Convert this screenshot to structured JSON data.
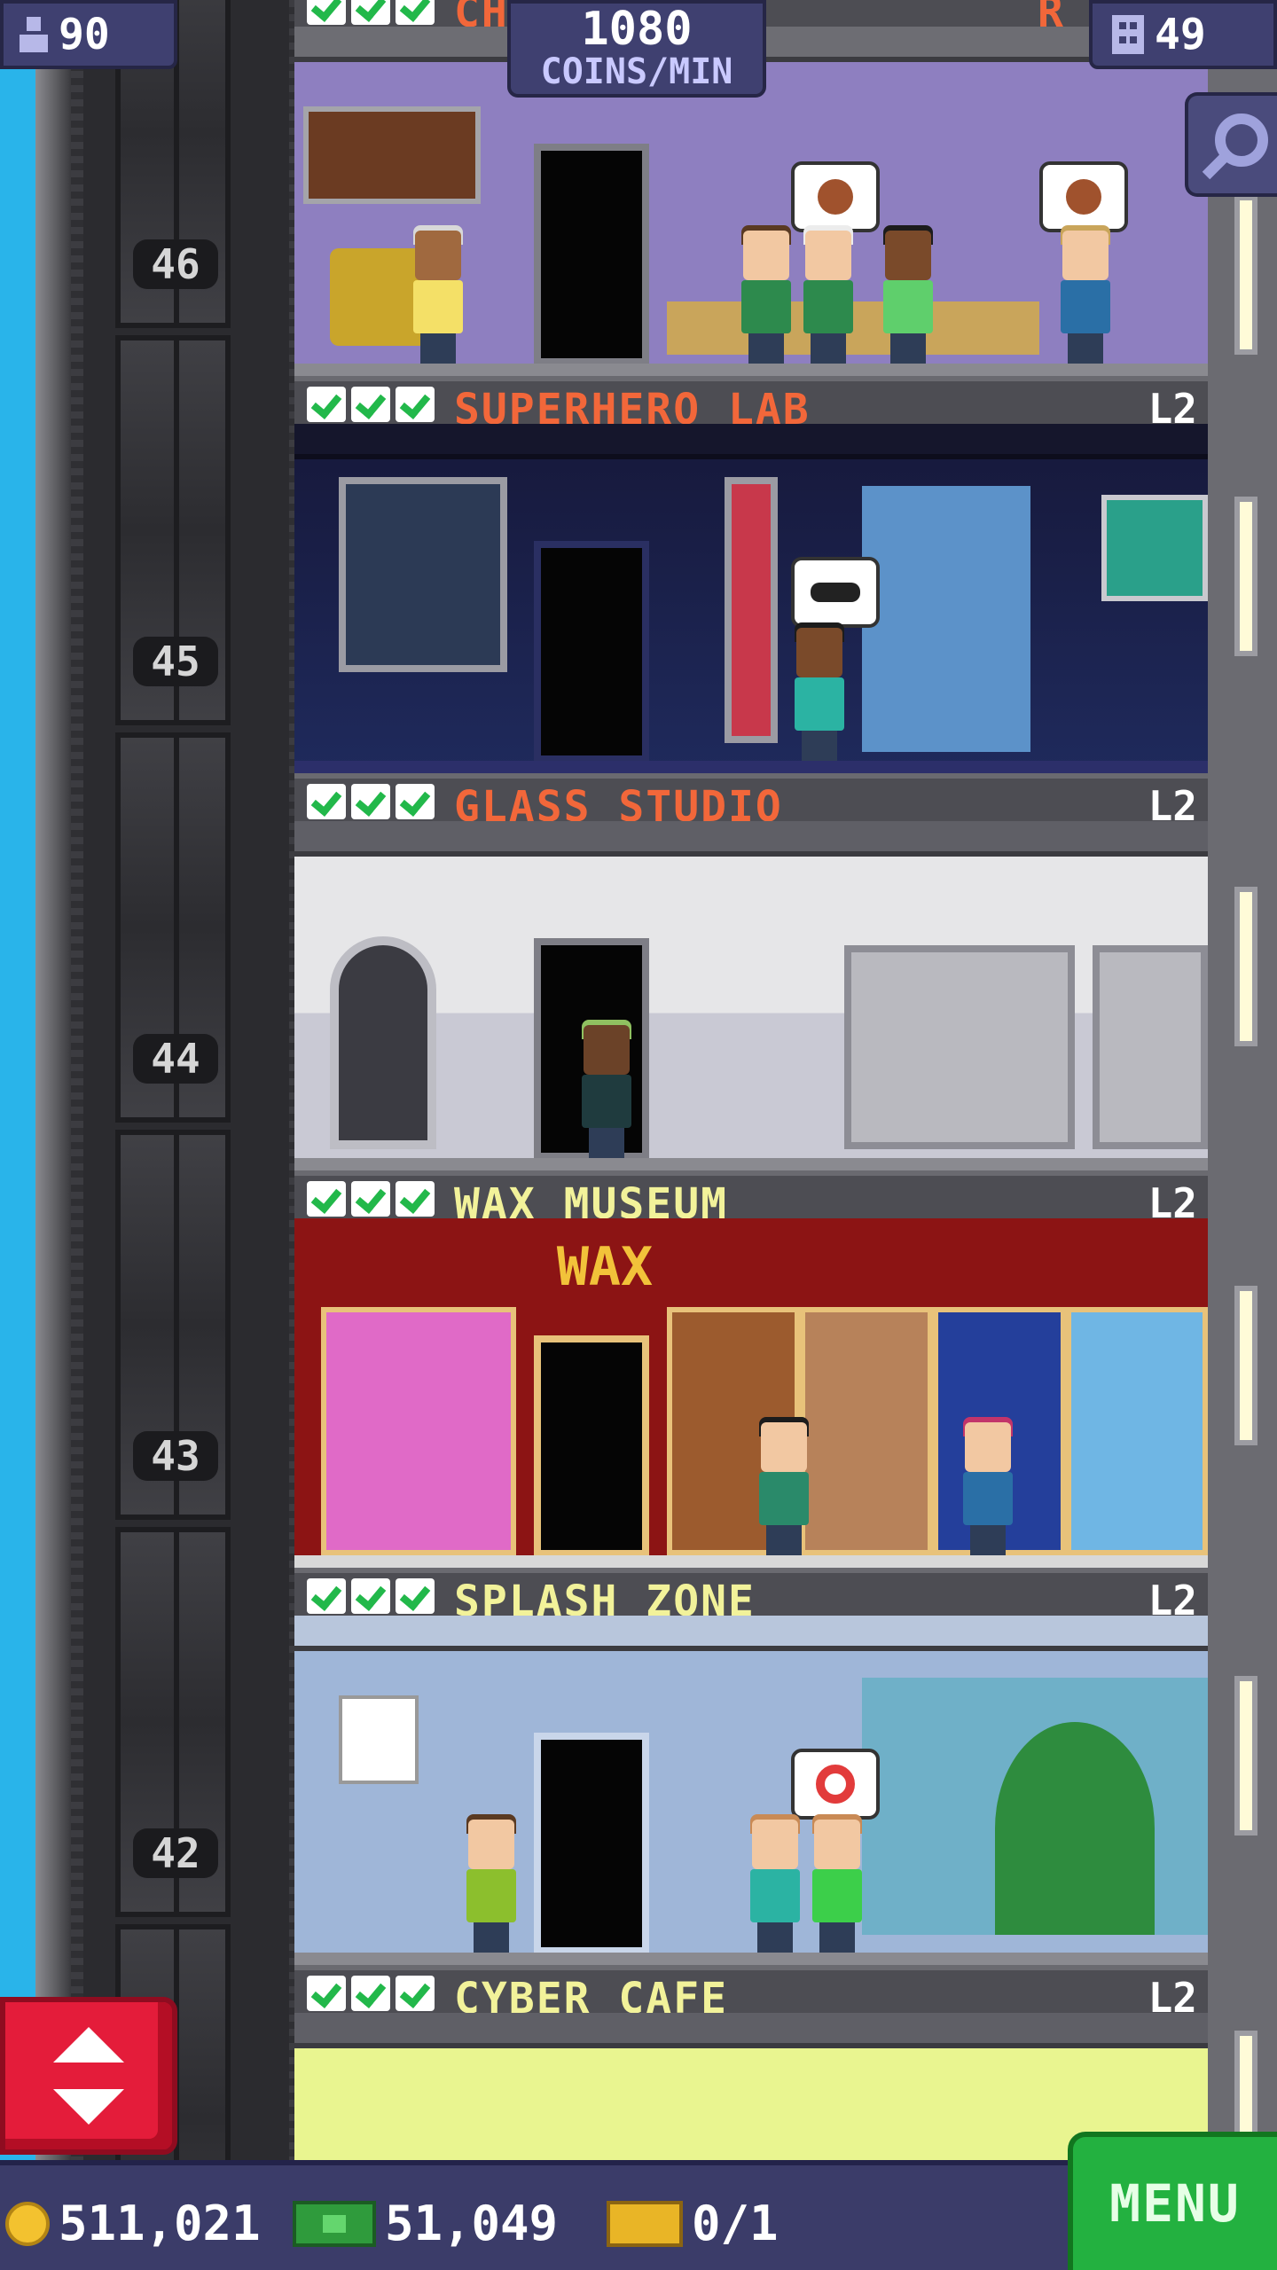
{
  "hud": {
    "population": "90",
    "population_icon": "person-icon",
    "coins_rate_value": "1080",
    "coins_rate_unit": "COINS/MIN",
    "floors_count": "49",
    "floors_icon": "building-icon",
    "search_icon": "magnifier-icon"
  },
  "shaft": {
    "floor_numbers": [
      "46",
      "45",
      "44",
      "43",
      "42"
    ]
  },
  "floors": [
    {
      "name": "CH",
      "name_tail": "R",
      "level": "",
      "name_color": "#f2673a",
      "checks": 3
    },
    {
      "name": "SUPERHERO LAB",
      "level": "L2",
      "name_color": "#f2673a",
      "checks": 3
    },
    {
      "name": "GLASS STUDIO",
      "level": "L2",
      "name_color": "#f2673a",
      "checks": 3
    },
    {
      "name": "WAX MUSEUM",
      "level": "L2",
      "name_color": "#f2f29a",
      "checks": 3,
      "sign": "WAX"
    },
    {
      "name": "SPLASH ZONE",
      "level": "L2",
      "name_color": "#f2f29a",
      "checks": 3
    },
    {
      "name": "CYBER CAFE",
      "level": "L2",
      "name_color": "#f2f29a",
      "checks": 3
    }
  ],
  "bottom": {
    "coins": "511,021",
    "bux": "51,049",
    "tickets": "0/1",
    "menu_label": "MENU"
  },
  "colors": {
    "sky": "#29b4ea",
    "hud_bg": "#3f4070",
    "menu_green": "#23b140",
    "elevator_red": "#e41c3a"
  }
}
